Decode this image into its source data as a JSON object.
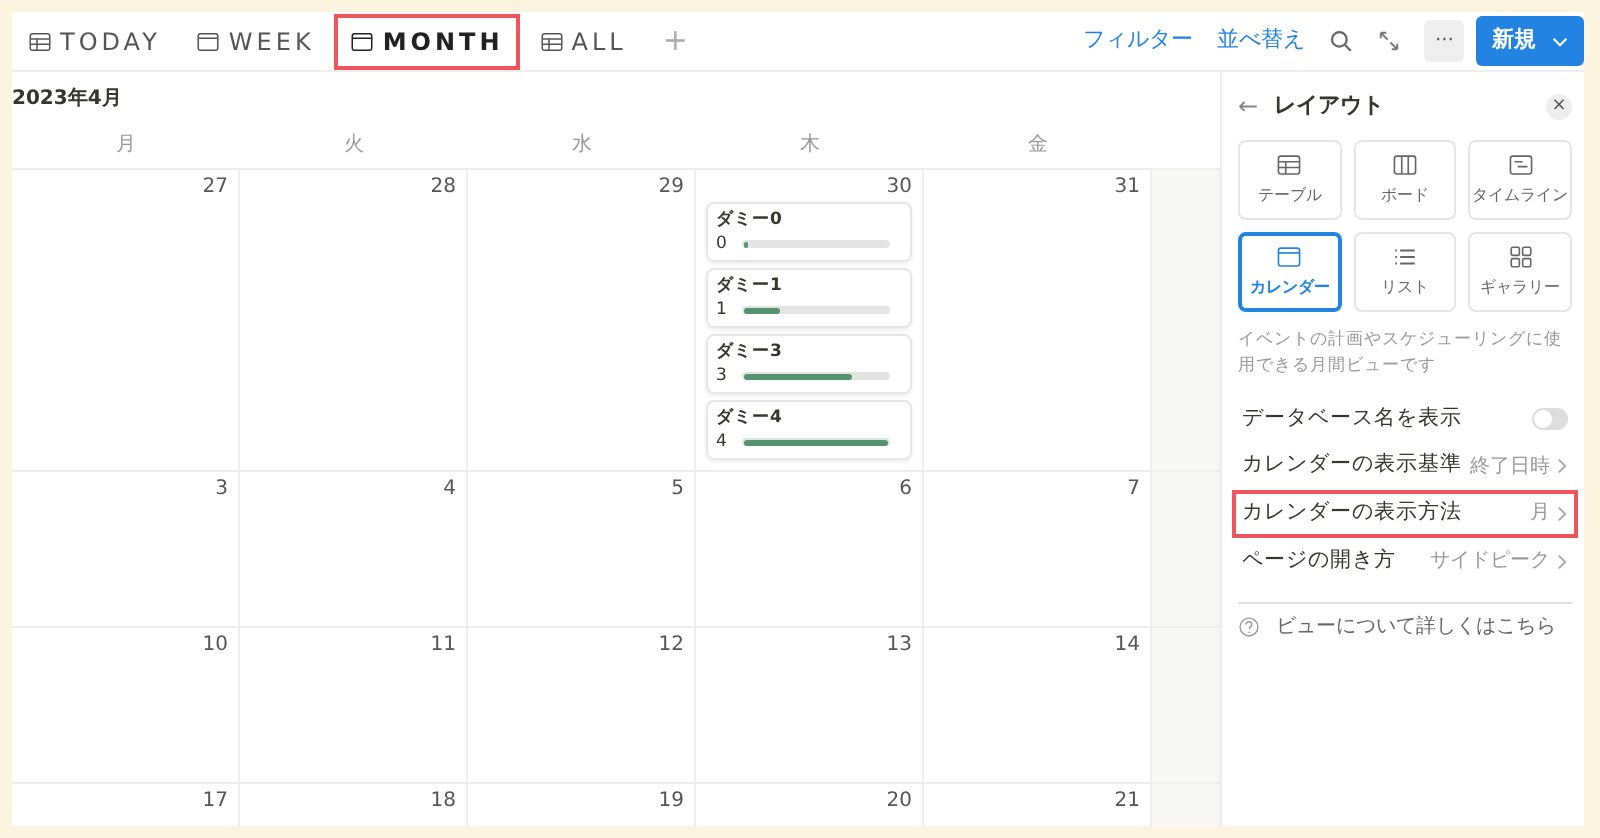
{
  "tabs": [
    {
      "label": "TODAY",
      "kind": "table",
      "selected": false,
      "highlighted": false
    },
    {
      "label": "WEEK",
      "kind": "calendar",
      "selected": false,
      "highlighted": false
    },
    {
      "label": "MONTH",
      "kind": "calendar",
      "selected": true,
      "highlighted": true
    },
    {
      "label": "ALL",
      "kind": "table",
      "selected": false,
      "highlighted": false
    }
  ],
  "add_tab": "+",
  "toolbar": {
    "filter": "フィルター",
    "sort": "並べ替え",
    "more": "···",
    "new_button": "新規"
  },
  "calendar": {
    "title": "2023年4月",
    "weekdays": [
      "月",
      "火",
      "水",
      "木",
      "金"
    ],
    "weeks": [
      {
        "days": [
          {
            "day": "27"
          },
          {
            "day": "28"
          },
          {
            "day": "29"
          },
          {
            "day": "30",
            "events": [
              {
                "title": "ダミー0",
                "reading": "0",
                "level": 0
              },
              {
                "title": "ダミー1",
                "reading": "1",
                "level": 0.25
              },
              {
                "title": "ダミー3",
                "reading": "3",
                "level": 0.75
              },
              {
                "title": "ダミー4",
                "reading": "4",
                "level": 1
              }
            ]
          },
          {
            "day": "31"
          }
        ]
      },
      {
        "days": [
          {
            "day": "3"
          },
          {
            "day": "4"
          },
          {
            "day": "5"
          },
          {
            "day": "6"
          },
          {
            "day": "7"
          }
        ]
      },
      {
        "days": [
          {
            "day": "10"
          },
          {
            "day": "11"
          },
          {
            "day": "12"
          },
          {
            "day": "13"
          },
          {
            "day": "14"
          }
        ]
      },
      {
        "days": [
          {
            "day": "17"
          },
          {
            "day": "18"
          },
          {
            "day": "19"
          },
          {
            "day": "20"
          },
          {
            "day": "21"
          }
        ]
      }
    ]
  },
  "panel": {
    "back": "←",
    "title": "レイアウト",
    "close": "×",
    "layouts": [
      {
        "label": "テーブル",
        "kind": "table",
        "selected": false
      },
      {
        "label": "ボード",
        "kind": "board",
        "selected": false
      },
      {
        "label": "タイムライン",
        "kind": "timeline",
        "selected": false
      },
      {
        "label": "カレンダー",
        "kind": "calendar",
        "selected": true
      },
      {
        "label": "リスト",
        "kind": "list",
        "selected": false
      },
      {
        "label": "ギャラリー",
        "kind": "gallery",
        "selected": false
      }
    ],
    "description": "イベントの計画やスケジューリングに使用できる月間ビューです",
    "settings": [
      {
        "kind": "toggle",
        "label": "データベース名を表示",
        "on": false,
        "highlighted": false
      },
      {
        "kind": "select",
        "label": "カレンダーの表示基準",
        "value": "終了日時",
        "highlighted": false
      },
      {
        "kind": "select",
        "label": "カレンダーの表示方法",
        "value": "月",
        "highlighted": true
      },
      {
        "kind": "select",
        "label": "ページの開き方",
        "value": "サイドピーク",
        "highlighted": false
      }
    ],
    "help": "ビューについて詳しくはこちら"
  }
}
